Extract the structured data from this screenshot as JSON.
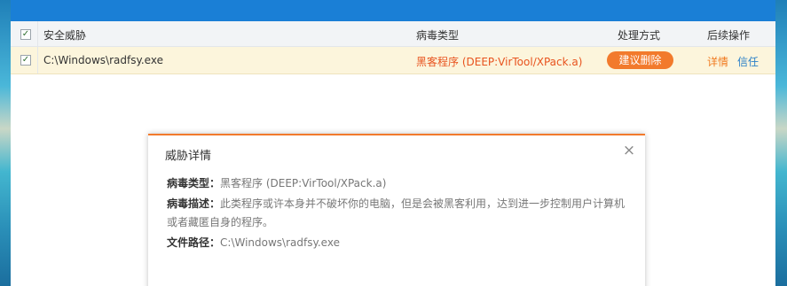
{
  "table": {
    "header": {
      "threat": "安全威胁",
      "virus_type": "病毒类型",
      "handling": "处理方式",
      "follow_up": "后续操作"
    },
    "rows": [
      {
        "checked": "✓",
        "path": "C:\\Windows\\radfsy.exe",
        "virus_type": "黑客程序 (DEEP:VirTool/XPack.a)",
        "handling_button": "建议删除",
        "detail_link": "详情",
        "trust_link": "信任"
      }
    ],
    "header_checked": "✓"
  },
  "popup": {
    "title": "威胁详情",
    "close": "×",
    "type_label": "病毒类型：",
    "type_value": "黑客程序 (DEEP:VirTool/XPack.a)",
    "desc_label": "病毒描述：",
    "desc_value_line1": "此类程序或许本身并不破坏你的电脑，但是会被黑客利用，达到进一步控制用户计算机",
    "desc_value_line2": "或者藏匿自身的程序。",
    "path_label": "文件路径：",
    "path_value": "C:\\Windows\\radfsy.exe"
  },
  "colors": {
    "titlebar": "#1a7fd6",
    "accent_orange": "#f27a2c",
    "row_highlight": "#fcf5dc",
    "link_blue": "#2a80c8"
  }
}
